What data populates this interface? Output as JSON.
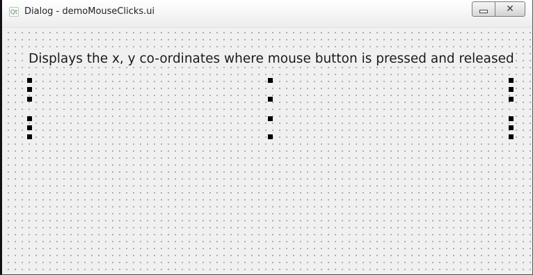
{
  "window": {
    "title": "Dialog - demoMouseClicks.ui",
    "app_icon_glyph": "Qt",
    "minimize_icon": "minimize-icon",
    "close_icon": "close-icon",
    "close_glyph": "✕"
  },
  "form": {
    "label_text": "Displays the x, y co-ordinates where mouse button is pressed and released",
    "background_color": "#f0f0f0",
    "grid_dot_color": "#9a9a9a",
    "handle_color": "#000000"
  }
}
